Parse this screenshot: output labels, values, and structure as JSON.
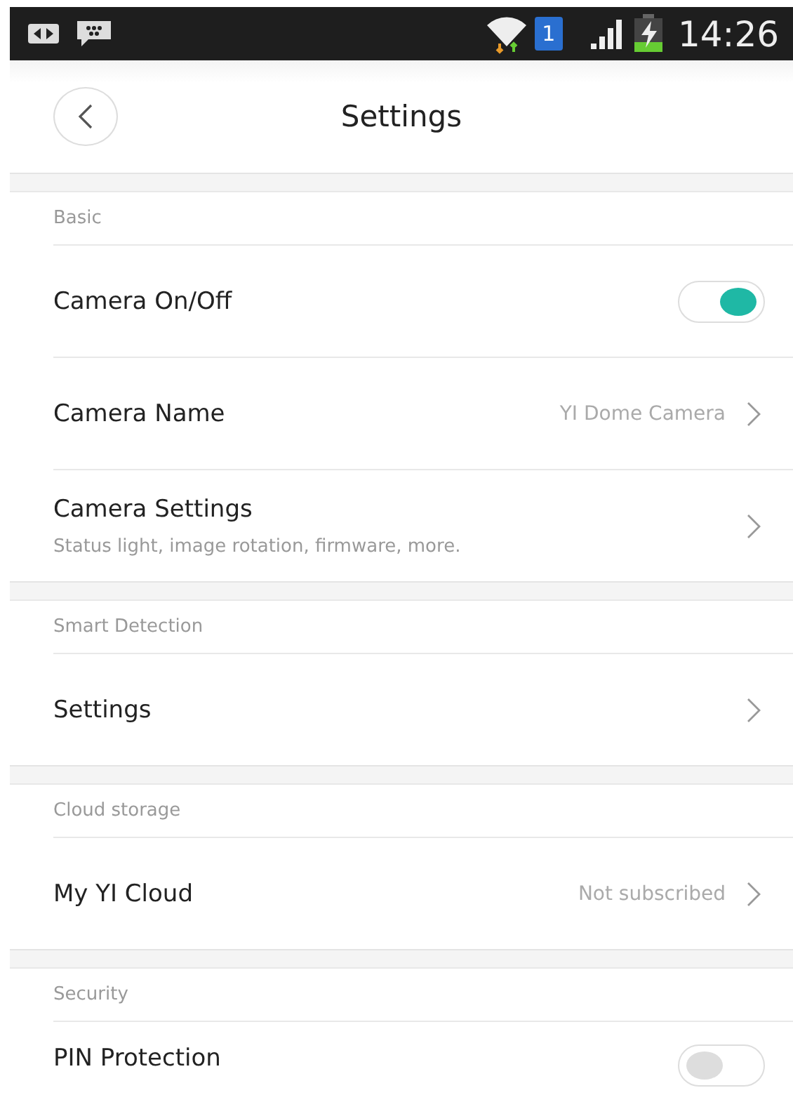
{
  "status_bar": {
    "sim_badge": "1",
    "time": "14:26"
  },
  "header": {
    "title": "Settings"
  },
  "sections": [
    {
      "title": "Basic",
      "items": [
        {
          "kind": "toggle",
          "label": "Camera On/Off",
          "on": true
        },
        {
          "kind": "link",
          "label": "Camera Name",
          "value": "YI Dome Camera"
        },
        {
          "kind": "link",
          "label": "Camera Settings",
          "subtitle": "Status light, image rotation, firmware, more."
        }
      ]
    },
    {
      "title": "Smart Detection",
      "items": [
        {
          "kind": "link",
          "label": "Settings"
        }
      ]
    },
    {
      "title": "Cloud storage",
      "items": [
        {
          "kind": "link",
          "label": "My YI Cloud",
          "value": "Not subscribed"
        }
      ]
    },
    {
      "title": "Security",
      "items": [
        {
          "kind": "toggle",
          "label": "PIN Protection",
          "on": false
        }
      ]
    }
  ]
}
